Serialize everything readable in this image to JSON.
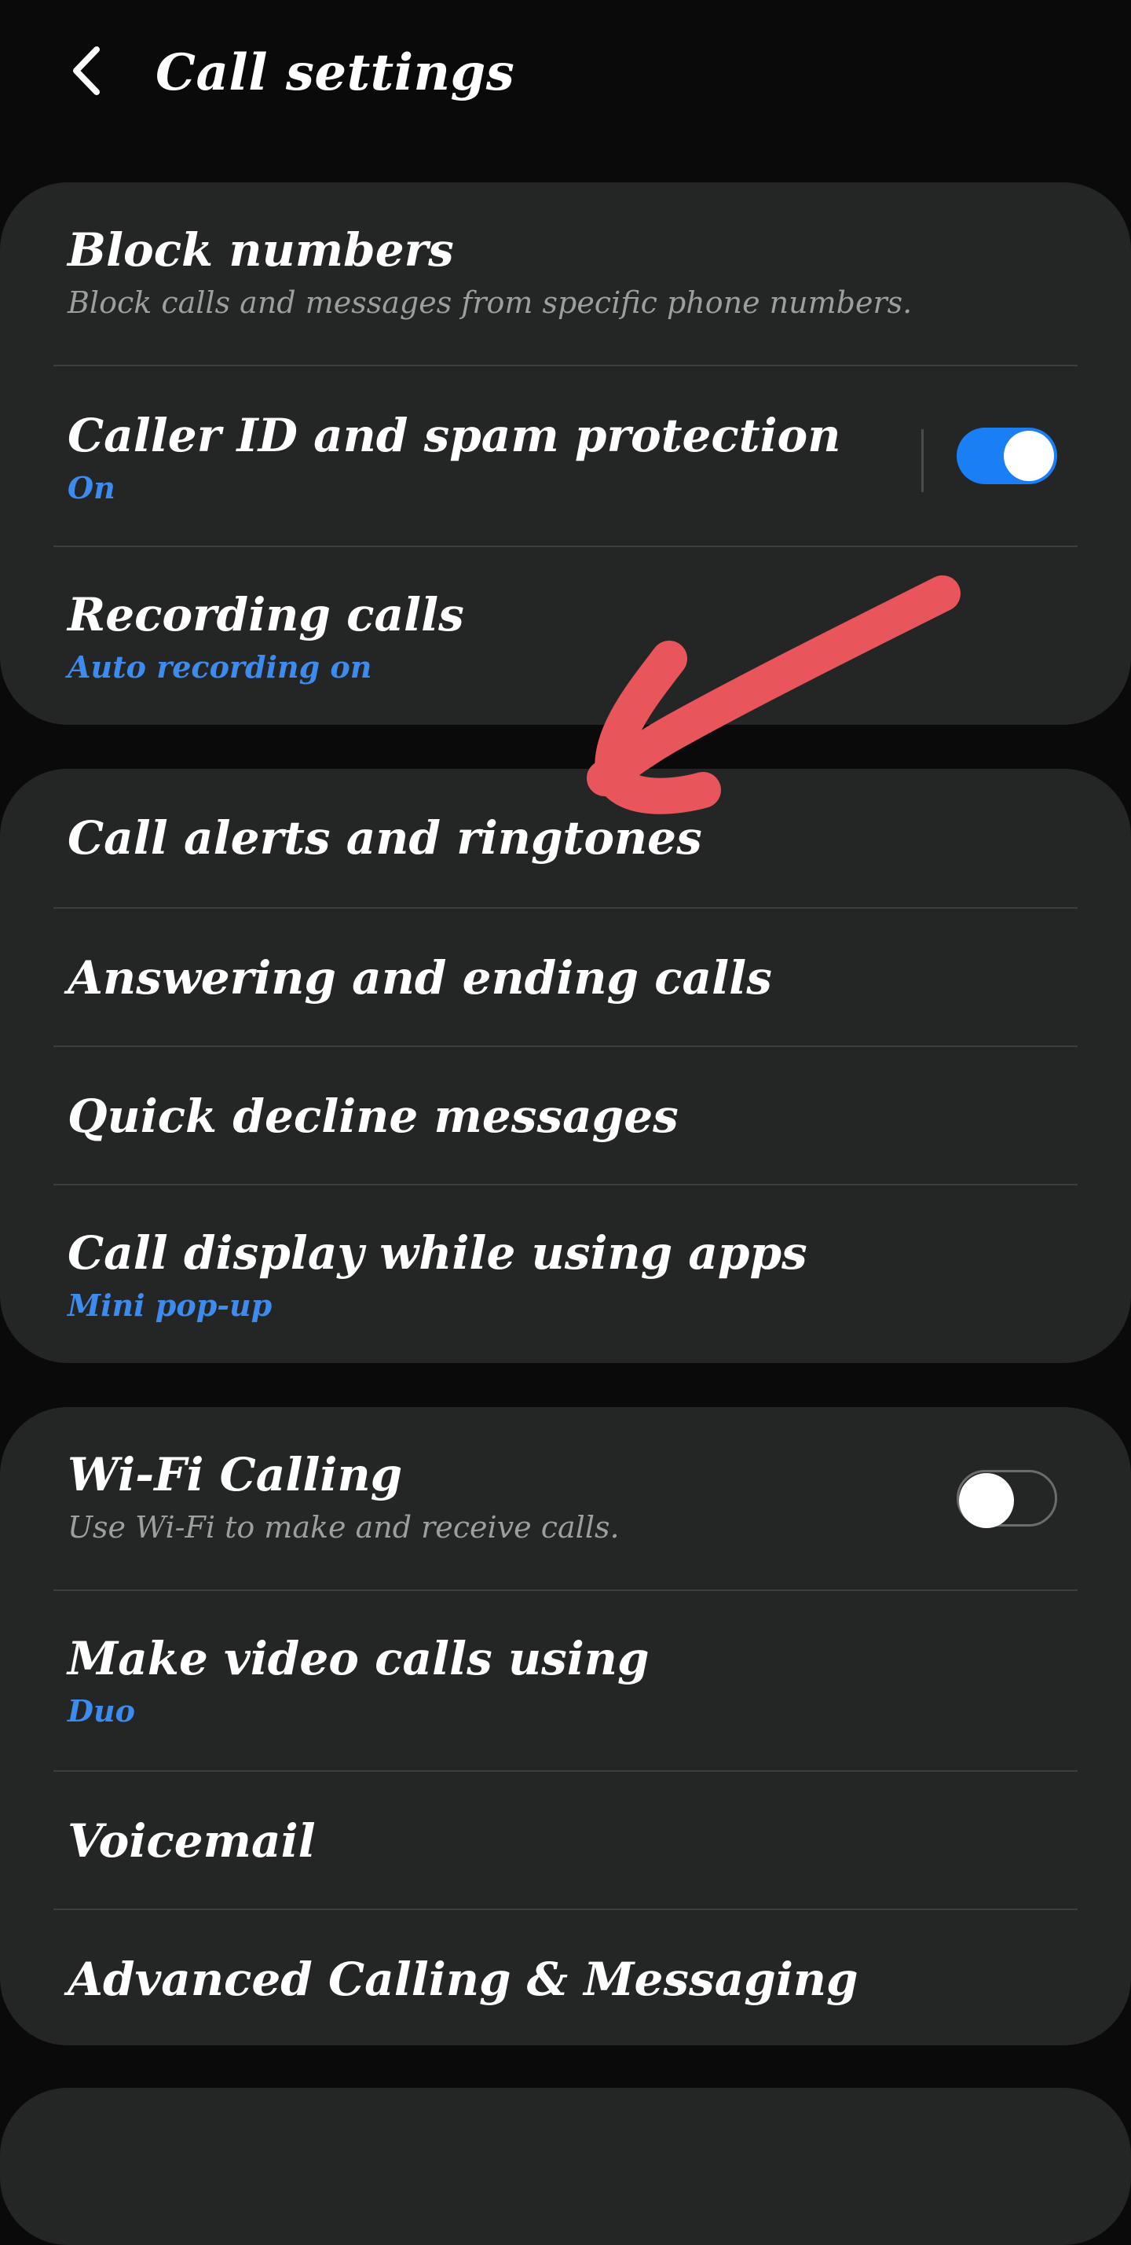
{
  "header": {
    "title": "Call settings",
    "back_icon": "chevron-left-icon"
  },
  "group1": {
    "items": [
      {
        "title": "Block numbers",
        "subtitle": "Block calls and messages from specific phone numbers."
      },
      {
        "title": "Caller ID and spam protection",
        "subtitle": "On",
        "toggle": "on"
      },
      {
        "title": "Recording calls",
        "subtitle": "Auto recording on"
      }
    ]
  },
  "group2": {
    "items": [
      {
        "title": "Call alerts and ringtones"
      },
      {
        "title": "Answering and ending calls"
      },
      {
        "title": "Quick decline messages"
      },
      {
        "title": "Call display while using apps",
        "subtitle": "Mini pop-up"
      }
    ]
  },
  "group3": {
    "items": [
      {
        "title": "Wi-Fi Calling",
        "subtitle": "Use Wi-Fi to make and receive calls.",
        "toggle": "off"
      },
      {
        "title": "Make video calls using",
        "subtitle": "Duo"
      },
      {
        "title": "Voicemail"
      },
      {
        "title": "Advanced Calling & Messaging"
      }
    ]
  },
  "colors": {
    "background": "#0a0a0a",
    "card": "#242625",
    "accent_blue": "#3e8bf0",
    "switch_on": "#1a7ff5",
    "annotation_arrow": "#e8555b",
    "subtitle_grey": "#9d9e9e"
  },
  "annotation": {
    "icon": "red-arrow-annotation"
  }
}
